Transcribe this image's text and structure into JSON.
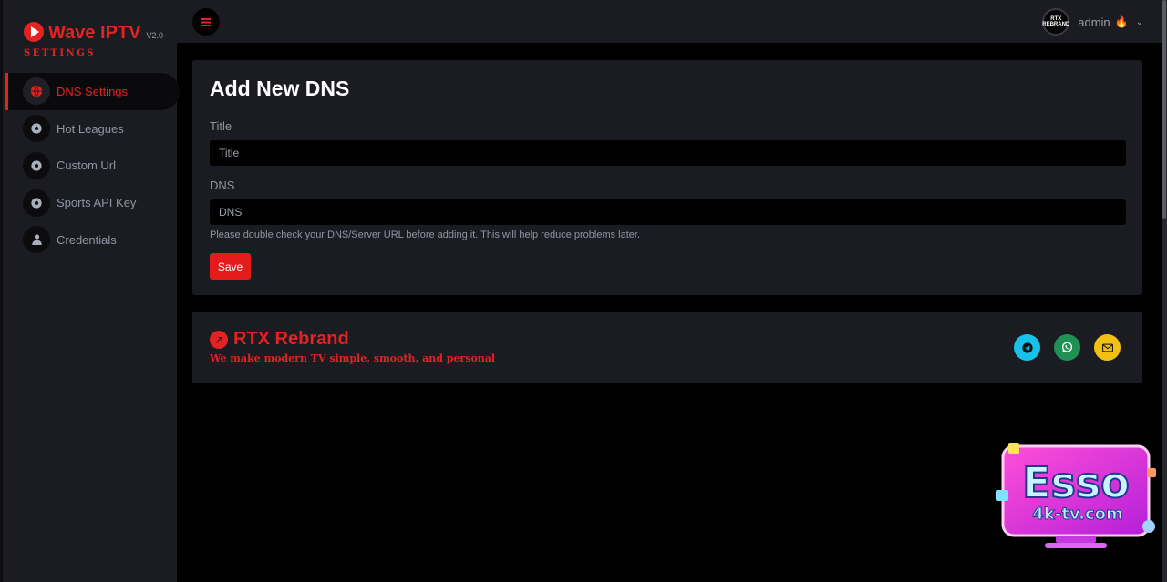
{
  "app": {
    "name": "Wave IPTV",
    "version": "V2.0",
    "section": "SETTINGS"
  },
  "sidebar": {
    "items": [
      {
        "label": "DNS Settings",
        "icon": "globe-icon",
        "active": true
      },
      {
        "label": "Hot Leagues",
        "icon": "soccer-ball-icon",
        "active": false
      },
      {
        "label": "Custom Url",
        "icon": "soccer-ball-icon",
        "active": false
      },
      {
        "label": "Sports API Key",
        "icon": "soccer-ball-icon",
        "active": false
      },
      {
        "label": "Credentials",
        "icon": "user-icon",
        "active": false
      }
    ]
  },
  "topbar": {
    "username": "admin",
    "avatar_text": "RTX REBRAND"
  },
  "form": {
    "heading": "Add New DNS",
    "title_label": "Title",
    "title_placeholder": "Title",
    "dns_label": "DNS",
    "dns_placeholder": "DNS",
    "hint": "Please double check your DNS/Server URL before adding it. This will help reduce problems later.",
    "save_label": "Save"
  },
  "footer": {
    "brand": "RTX Rebrand",
    "tagline": "We make modern TV simple, smooth, and personal",
    "social": [
      "telegram-icon",
      "whatsapp-icon",
      "mail-icon"
    ]
  },
  "watermark": {
    "text": "Esso",
    "url": "4k-tv.com"
  },
  "colors": {
    "accent": "#e32222",
    "panel": "#1b1c22",
    "background": "#000000",
    "telegram": "#16c2ea",
    "whatsapp": "#1f9155",
    "mail": "#f2c012"
  }
}
